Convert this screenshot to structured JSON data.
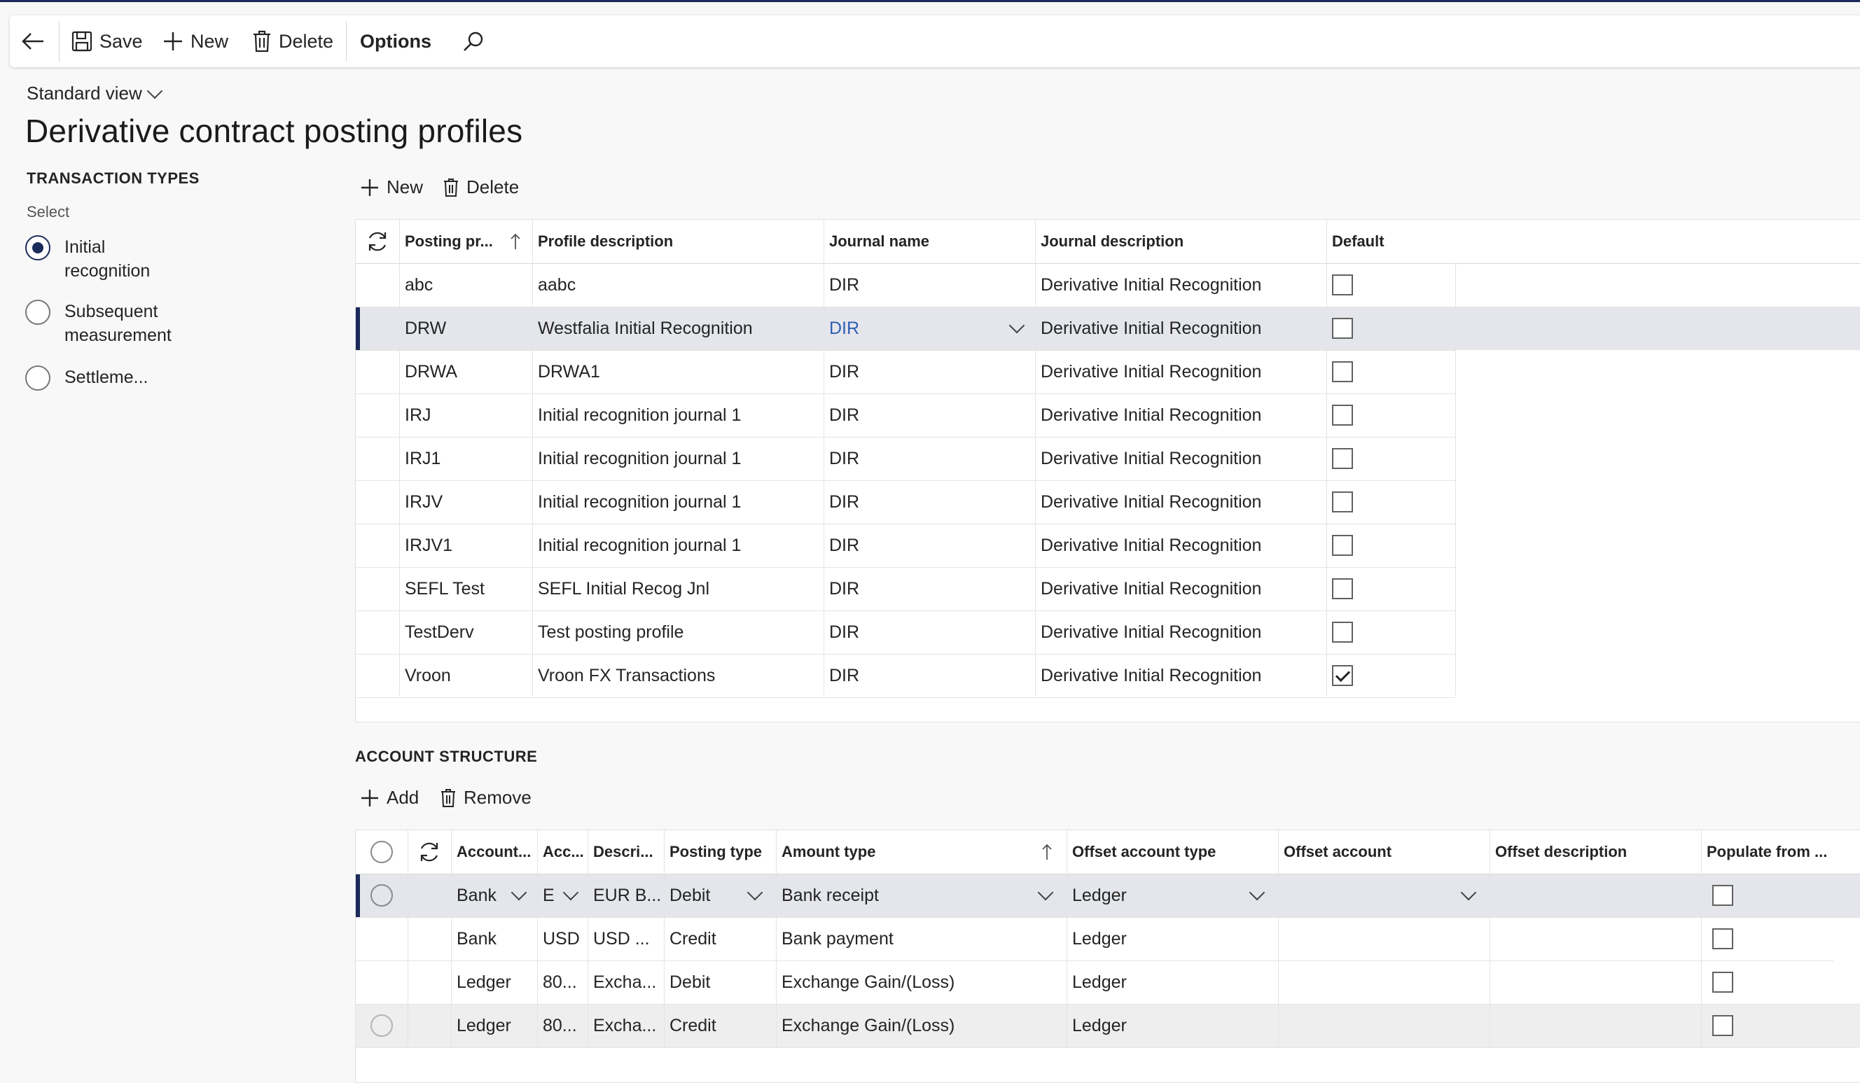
{
  "toolbar": {
    "save_label": "Save",
    "new_label": "New",
    "delete_label": "Delete",
    "options_label": "Options"
  },
  "header": {
    "view_label": "Standard view",
    "title": "Derivative contract posting profiles"
  },
  "transaction_types": {
    "heading": "TRANSACTION TYPES",
    "select_label": "Select",
    "options": [
      {
        "label": "Initial recognition",
        "selected": true
      },
      {
        "label": "Subsequent measurement",
        "selected": false
      },
      {
        "label": "Settleme...",
        "selected": false
      }
    ]
  },
  "profiles": {
    "new_label": "New",
    "delete_label": "Delete",
    "columns": [
      "Posting pr...",
      "Profile description",
      "Journal name",
      "Journal description",
      "Default"
    ],
    "rows": [
      {
        "code": "abc",
        "description": "aabc",
        "journal": "DIR",
        "journal_desc": "Derivative Initial Recognition",
        "default": false
      },
      {
        "code": "DRW",
        "description": "Westfalia Initial Recognition",
        "journal": "DIR",
        "journal_desc": "Derivative Initial Recognition",
        "default": false
      },
      {
        "code": "DRWA",
        "description": "DRWA1",
        "journal": "DIR",
        "journal_desc": "Derivative Initial Recognition",
        "default": false
      },
      {
        "code": "IRJ",
        "description": "Initial recognition journal 1",
        "journal": "DIR",
        "journal_desc": "Derivative Initial Recognition",
        "default": false
      },
      {
        "code": "IRJ1",
        "description": "Initial recognition journal 1",
        "journal": "DIR",
        "journal_desc": "Derivative Initial Recognition",
        "default": false
      },
      {
        "code": "IRJV",
        "description": "Initial recognition journal 1",
        "journal": "DIR",
        "journal_desc": "Derivative Initial Recognition",
        "default": false
      },
      {
        "code": "IRJV1",
        "description": "Initial recognition journal 1",
        "journal": "DIR",
        "journal_desc": "Derivative Initial Recognition",
        "default": false
      },
      {
        "code": "SEFL Test",
        "description": "SEFL Initial Recog Jnl",
        "journal": "DIR",
        "journal_desc": "Derivative Initial Recognition",
        "default": false
      },
      {
        "code": "TestDerv",
        "description": "Test posting profile",
        "journal": "DIR",
        "journal_desc": "Derivative Initial Recognition",
        "default": false
      },
      {
        "code": "Vroon",
        "description": "Vroon FX Transactions",
        "journal": "DIR",
        "journal_desc": "Derivative Initial Recognition",
        "default": true
      }
    ]
  },
  "account_structure": {
    "heading": "ACCOUNT STRUCTURE",
    "add_label": "Add",
    "remove_label": "Remove",
    "columns": [
      "Account...",
      "Acc...",
      "Descri...",
      "Posting type",
      "Amount type",
      "Offset account type",
      "Offset account",
      "Offset description",
      "Populate from ..."
    ],
    "rows": [
      {
        "account_type": "Bank",
        "account": "E",
        "description": "EUR B...",
        "posting_type": "Debit",
        "amount_type": "Bank receipt",
        "offset_type": "Ledger",
        "offset_account": "",
        "offset_desc": "",
        "populate": false
      },
      {
        "account_type": "Bank",
        "account": "USD",
        "description": "USD ...",
        "posting_type": "Credit",
        "amount_type": "Bank payment",
        "offset_type": "Ledger",
        "offset_account": "",
        "offset_desc": "",
        "populate": false
      },
      {
        "account_type": "Ledger",
        "account": "80...",
        "description": "Excha...",
        "posting_type": "Debit",
        "amount_type": "Exchange Gain/(Loss)",
        "offset_type": "Ledger",
        "offset_account": "",
        "offset_desc": "",
        "populate": false
      },
      {
        "account_type": "Ledger",
        "account": "80...",
        "description": "Excha...",
        "posting_type": "Credit",
        "amount_type": "Exchange Gain/(Loss)",
        "offset_type": "Ledger",
        "offset_account": "",
        "offset_desc": "",
        "populate": false
      }
    ]
  }
}
